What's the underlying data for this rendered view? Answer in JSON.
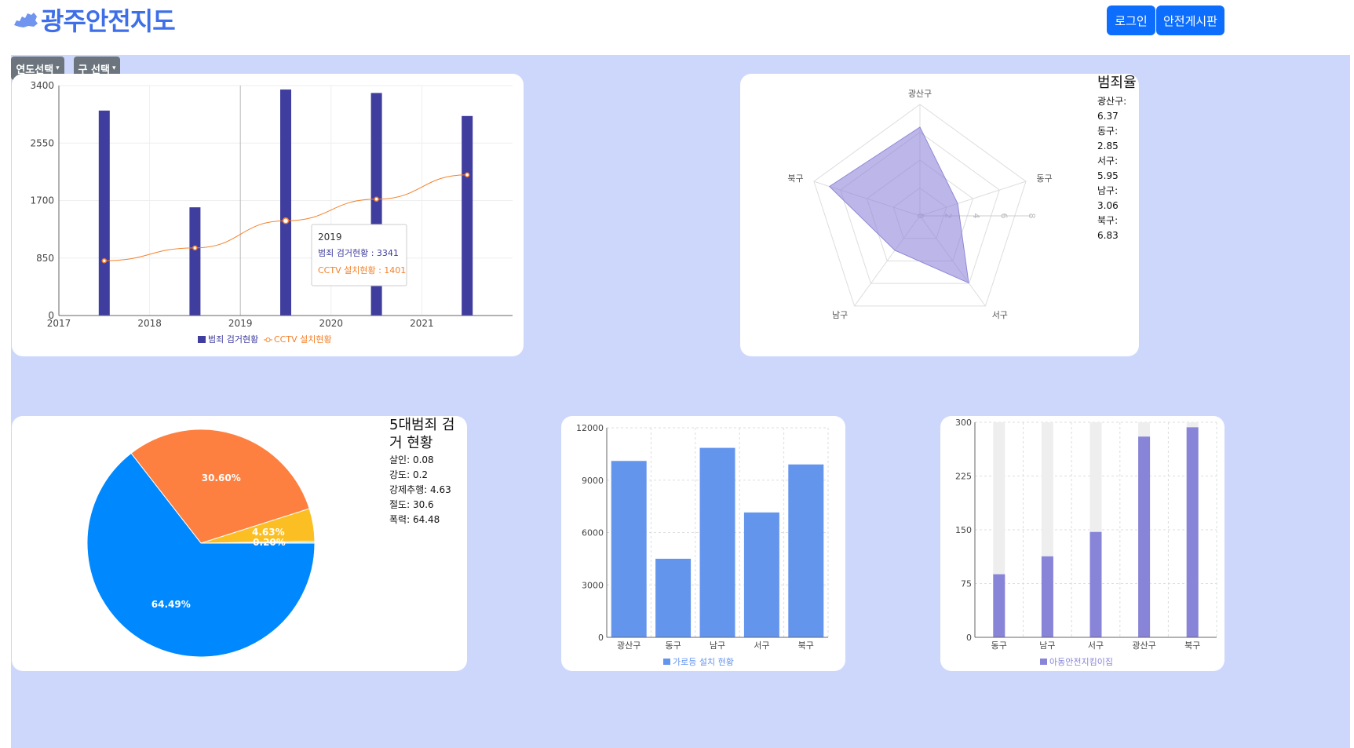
{
  "header": {
    "logo_text": "광주안전지도",
    "login_label": "로그인",
    "board_label": "안전게시판"
  },
  "filters": {
    "year_label": "연도선택",
    "district_label": "구 선택"
  },
  "combo_chart": {
    "chart_data": {
      "type": "bar",
      "categories": [
        "2017",
        "2018",
        "2019",
        "2020",
        "2021"
      ],
      "series": [
        {
          "name": "범죄 검거현황",
          "type": "bar",
          "values": [
            3030,
            1600,
            3341,
            3290,
            2950
          ],
          "color": "#3f3d9e"
        },
        {
          "name": "CCTV 설치현황",
          "type": "line",
          "values": [
            810,
            1000,
            1401,
            1720,
            2080
          ],
          "color": "#f4802a"
        }
      ],
      "ylim": [
        0,
        3400
      ],
      "yticks": [
        0,
        850,
        1700,
        2550,
        3400
      ],
      "xticks": [
        "2017",
        "2018",
        "2019",
        "2020",
        "2021"
      ]
    },
    "tooltip": {
      "title": "2019",
      "bar_label": "범죄 검거현황 : 3341",
      "line_label": "CCTV 설치현황 : 1401"
    },
    "legend": {
      "bar": "범죄 검거현황",
      "line": "CCTV 설치현황"
    }
  },
  "radar_chart": {
    "title": "범죄율",
    "list": [
      "광산구:",
      "6.37",
      "동구: 2.85",
      "서구: 5.95",
      "남구: 3.06",
      "북구: 6.83"
    ],
    "chart_data": {
      "type": "radar",
      "axes": [
        "광산구",
        "동구",
        "서구",
        "남구",
        "북구"
      ],
      "values": [
        6.37,
        2.85,
        5.95,
        3.06,
        6.83
      ],
      "rticks": [
        "0",
        "2",
        "4",
        "6",
        "8"
      ],
      "rmax": 8,
      "color": "#8f87d8"
    }
  },
  "pie_chart": {
    "title": "5대범죄 검거 현황",
    "list": [
      "살인: 0.08",
      "강도: 0.2",
      "강제추행: 4.63",
      "절도: 30.6",
      "폭력: 64.48"
    ],
    "chart_data": {
      "type": "pie",
      "labels": [
        "살인",
        "강도",
        "강제추행",
        "절도",
        "폭력"
      ],
      "values": [
        0.08,
        0.2,
        4.63,
        30.6,
        64.48
      ],
      "slice_labels": [
        "",
        "0.20%",
        "4.63%",
        "30.60%",
        "64.49%"
      ],
      "colors": [
        "#6ee7b7",
        "#22c3d8",
        "#fbbf24",
        "#fd8040",
        "#0088fe"
      ]
    }
  },
  "streetlight_chart": {
    "legend": "가로등 설치 현황",
    "chart_data": {
      "type": "bar",
      "categories": [
        "광산구",
        "동구",
        "남구",
        "서구",
        "북구"
      ],
      "values": [
        10100,
        4500,
        10850,
        7150,
        9900
      ],
      "ylim": [
        0,
        12000
      ],
      "yticks": [
        "0",
        "3000",
        "6000",
        "9000",
        "12000"
      ],
      "color": "#6495ed"
    }
  },
  "childsafety_chart": {
    "legend": "아동안전지킴이집",
    "chart_data": {
      "type": "bar",
      "categories": [
        "동구",
        "남구",
        "서구",
        "광산구",
        "북구"
      ],
      "values": [
        88,
        113,
        147,
        280,
        293
      ],
      "ylim": [
        0,
        300
      ],
      "yticks": [
        "0",
        "75",
        "150",
        "225",
        "300"
      ],
      "color": "#8884d8",
      "background_color": "#eeeeee"
    }
  }
}
